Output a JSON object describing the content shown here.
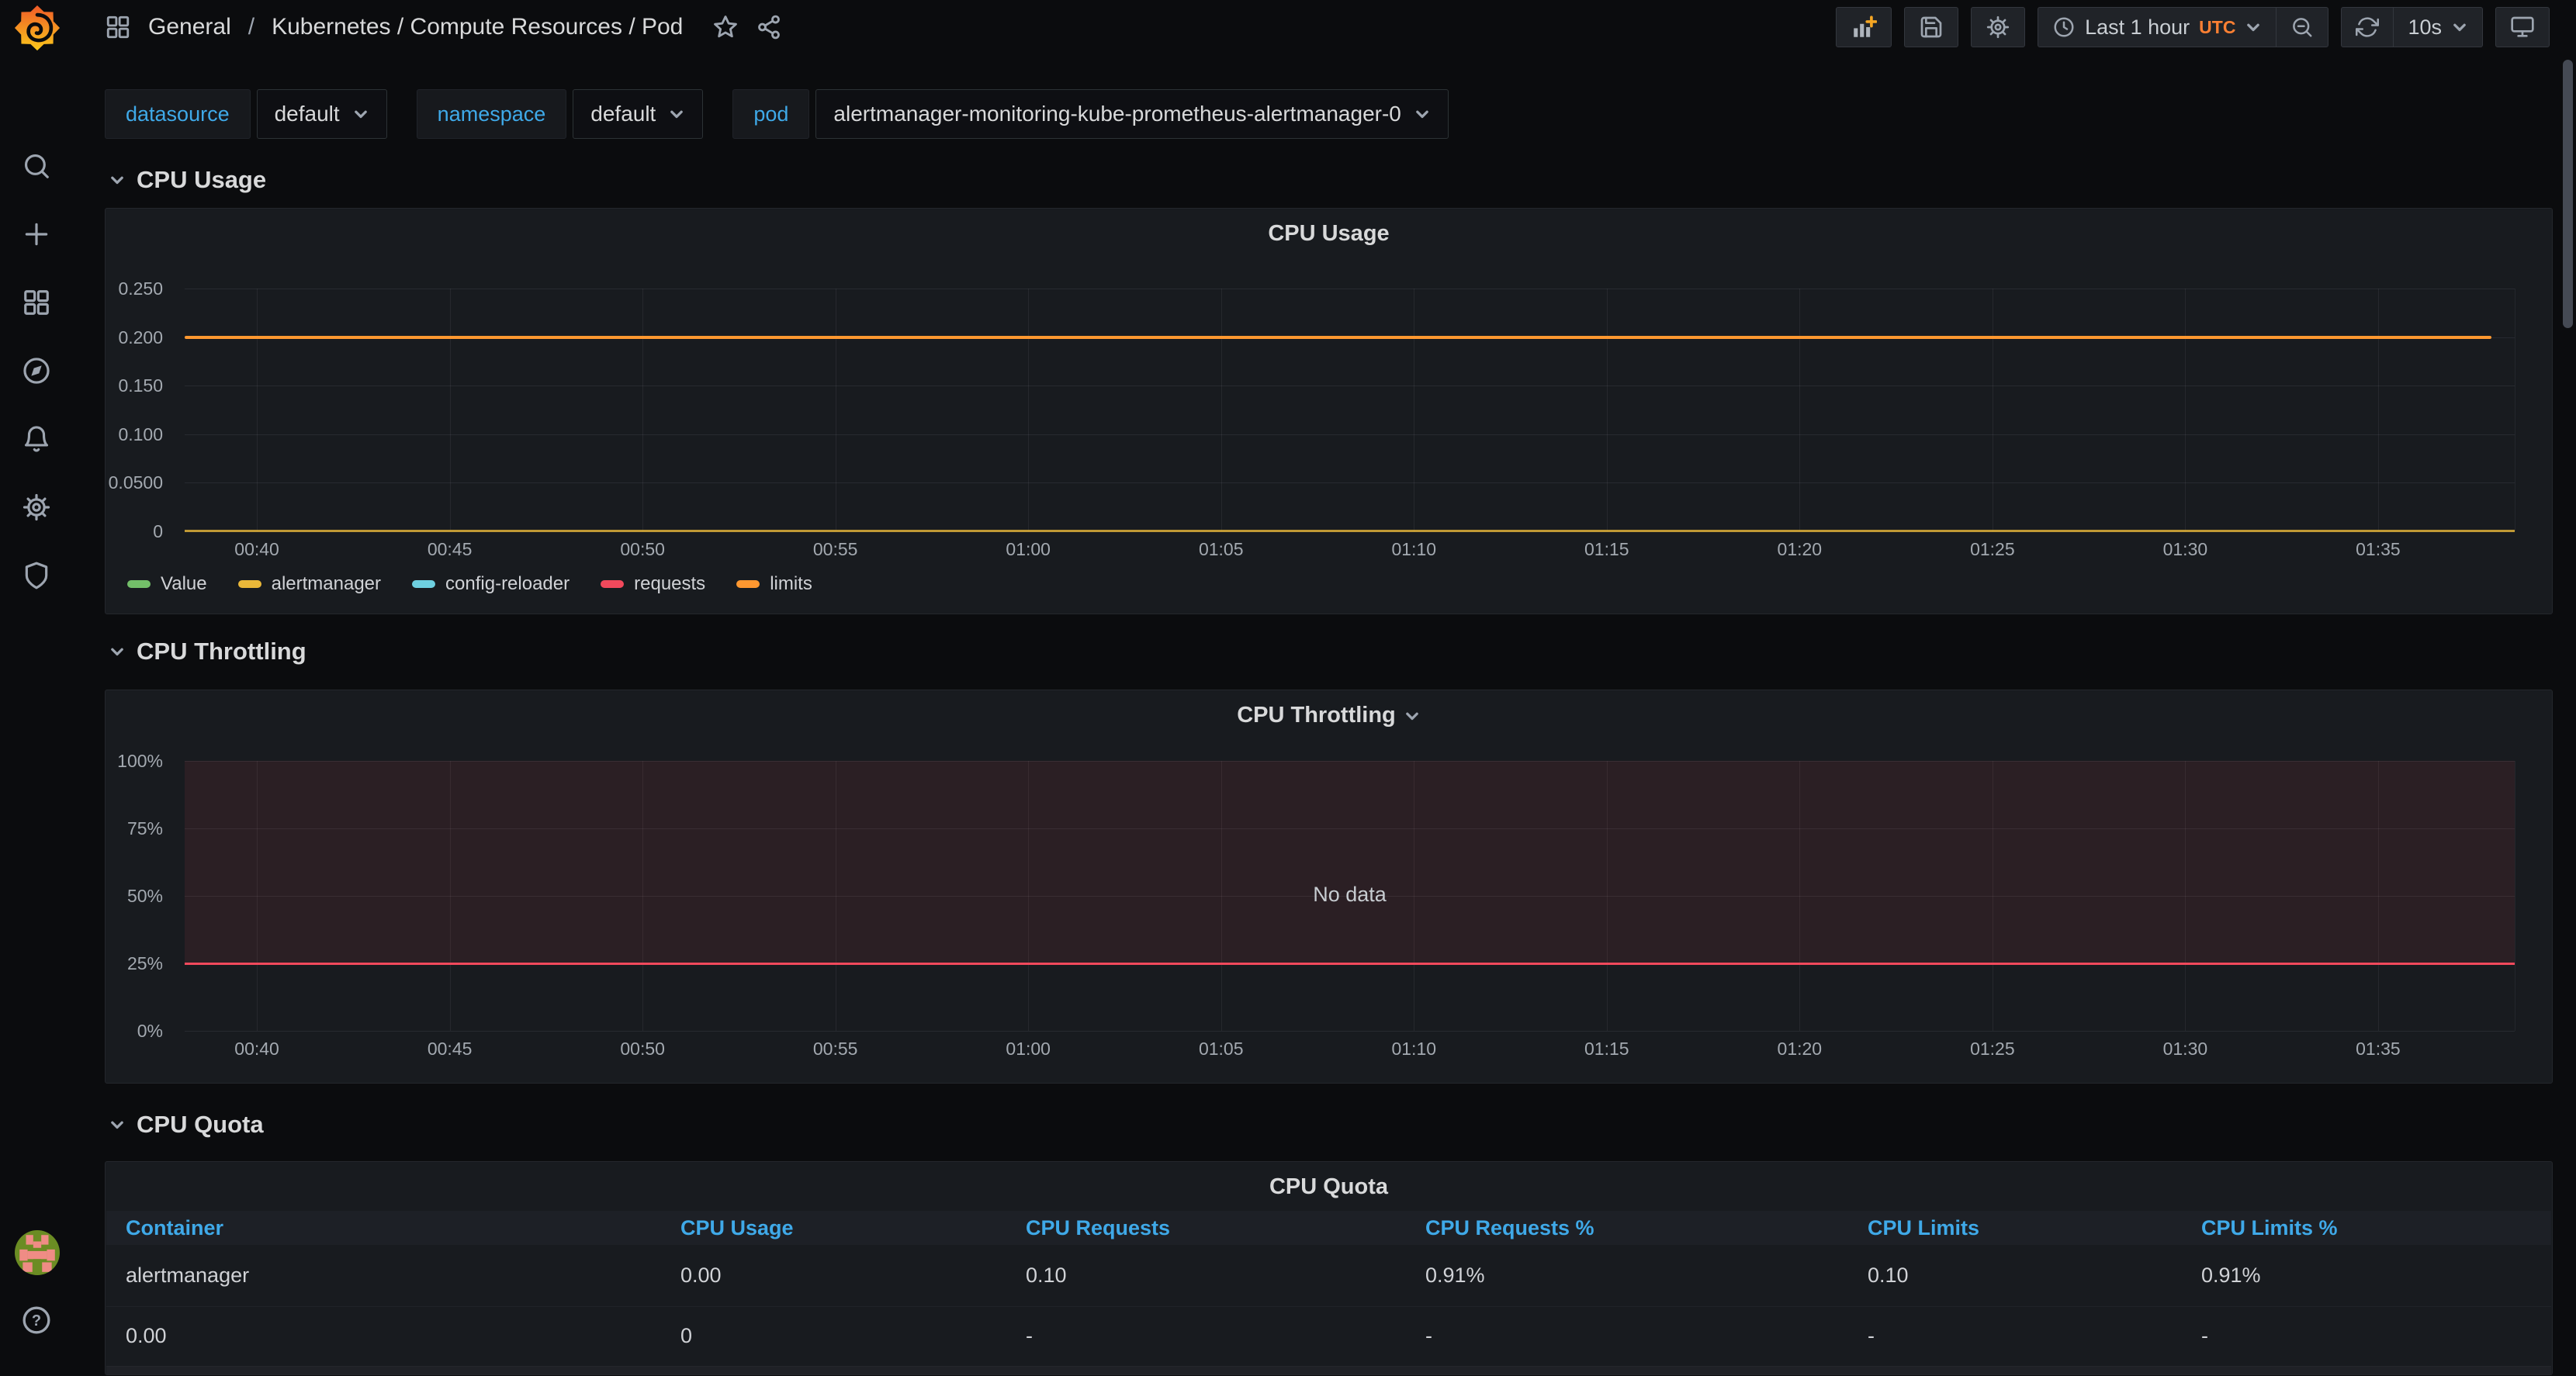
{
  "topnav": {
    "breadcrumb": {
      "root": "General",
      "separator": "/",
      "dashboard_title": "Kubernetes / Compute Resources / Pod"
    },
    "time_picker": {
      "label": "Last 1 hour",
      "timezone": "UTC"
    },
    "refresh": {
      "interval": "10s"
    },
    "icons": [
      "apps-grid-icon",
      "star-icon",
      "share-icon",
      "add-panel-icon",
      "save-dashboard-icon",
      "dashboard-settings-icon",
      "clock-icon",
      "zoom-out-icon",
      "refresh-icon",
      "cycle-view-icon"
    ]
  },
  "sidebar": {
    "icons": [
      "grafana-logo",
      "search-icon",
      "create-icon",
      "dashboards-icon",
      "explore-compass-icon",
      "alerting-bell-icon",
      "configuration-gear-icon",
      "server-admin-shield-icon",
      "user-avatar",
      "help-icon"
    ]
  },
  "variables": [
    {
      "label": "datasource",
      "value": "default"
    },
    {
      "label": "namespace",
      "value": "default"
    },
    {
      "label": "pod",
      "value": "alertmanager-monitoring-kube-prometheus-alertmanager-0"
    }
  ],
  "sections": [
    {
      "title": "CPU Usage"
    },
    {
      "title": "CPU Throttling"
    },
    {
      "title": "CPU Quota"
    }
  ],
  "panels": {
    "cpu_usage": {
      "title": "CPU Usage",
      "y_ticks": [
        "0.250",
        "0.200",
        "0.150",
        "0.100",
        "0.0500",
        "0"
      ],
      "x_ticks": [
        "00:40",
        "00:45",
        "00:50",
        "00:55",
        "01:00",
        "01:05",
        "01:10",
        "01:15",
        "01:20",
        "01:25",
        "01:30",
        "01:35"
      ],
      "legend": [
        {
          "label": "Value",
          "color": "#73bf69"
        },
        {
          "label": "alertmanager",
          "color": "#eab839"
        },
        {
          "label": "config-reloader",
          "color": "#6ed0e0"
        },
        {
          "label": "requests",
          "color": "#f2495c"
        },
        {
          "label": "limits",
          "color": "#ff9830"
        }
      ]
    },
    "cpu_throttling": {
      "title": "CPU Throttling",
      "y_ticks": [
        "100%",
        "75%",
        "50%",
        "25%",
        "0%"
      ],
      "x_ticks": [
        "00:40",
        "00:45",
        "00:50",
        "00:55",
        "01:00",
        "01:05",
        "01:10",
        "01:15",
        "01:20",
        "01:25",
        "01:30",
        "01:35"
      ],
      "no_data_text": "No data"
    },
    "cpu_quota": {
      "title": "CPU Quota",
      "columns": [
        "Container",
        "CPU Usage",
        "CPU Requests",
        "CPU Requests %",
        "CPU Limits",
        "CPU Limits %"
      ],
      "rows": [
        [
          "alertmanager",
          "0.00",
          "0.10",
          "0.91%",
          "0.10",
          "0.91%"
        ],
        [
          "0.00",
          "0",
          "-",
          "-",
          "-",
          "-"
        ]
      ]
    }
  },
  "colors": {
    "link_blue": "#3fa9e8",
    "orange_limits": "#ff9830",
    "yellow_alertmanager": "#eab839",
    "green_value": "#73bf69",
    "cyan_config_reloader": "#6ed0e0",
    "red_requests": "#f2495c",
    "utc_orange": "#ff8033",
    "panel_bg": "#181b1f",
    "page_bg": "#0b0c0e"
  },
  "chart_data": [
    {
      "type": "line",
      "title": "CPU Usage",
      "x": [
        "00:40",
        "00:45",
        "00:50",
        "00:55",
        "01:00",
        "01:05",
        "01:10",
        "01:15",
        "01:20",
        "01:25",
        "01:30",
        "01:35"
      ],
      "ylabel": "",
      "ylim": [
        0,
        0.25
      ],
      "y_tick_labels": [
        "0",
        "0.0500",
        "0.100",
        "0.150",
        "0.200",
        "0.250"
      ],
      "grid": true,
      "legend_position": "bottom-left",
      "legend_entries": [
        "Value",
        "alertmanager",
        "config-reloader",
        "requests",
        "limits"
      ],
      "series": [
        {
          "name": "limits",
          "color": "#ff9830",
          "shape": "constant",
          "value": 0.2
        },
        {
          "name": "alertmanager",
          "color": "#eab839",
          "shape": "constant",
          "value": 0.001
        }
      ]
    },
    {
      "type": "line",
      "title": "CPU Throttling",
      "x": [
        "00:40",
        "00:45",
        "00:50",
        "00:55",
        "01:00",
        "01:05",
        "01:10",
        "01:15",
        "01:20",
        "01:25",
        "01:30",
        "01:35"
      ],
      "ylim": [
        0,
        100
      ],
      "y_tick_labels": [
        "0%",
        "25%",
        "50%",
        "75%",
        "100%"
      ],
      "grid": true,
      "annotation": "No data",
      "series": [
        {
          "name": "threshold",
          "color": "#f2495c",
          "shape": "constant",
          "value_percent": 25
        }
      ],
      "fill_region_percent": [
        25,
        100
      ],
      "fill_color": "rgba(242,73,92,0.09)"
    },
    {
      "type": "table",
      "title": "CPU Quota",
      "columns": [
        "Container",
        "CPU Usage",
        "CPU Requests",
        "CPU Requests %",
        "CPU Limits",
        "CPU Limits %"
      ],
      "rows": [
        [
          "alertmanager",
          "0.00",
          "0.10",
          "0.91%",
          "0.10",
          "0.91%"
        ],
        [
          "0.00",
          "0",
          "-",
          "-",
          "-",
          "-"
        ]
      ]
    }
  ]
}
